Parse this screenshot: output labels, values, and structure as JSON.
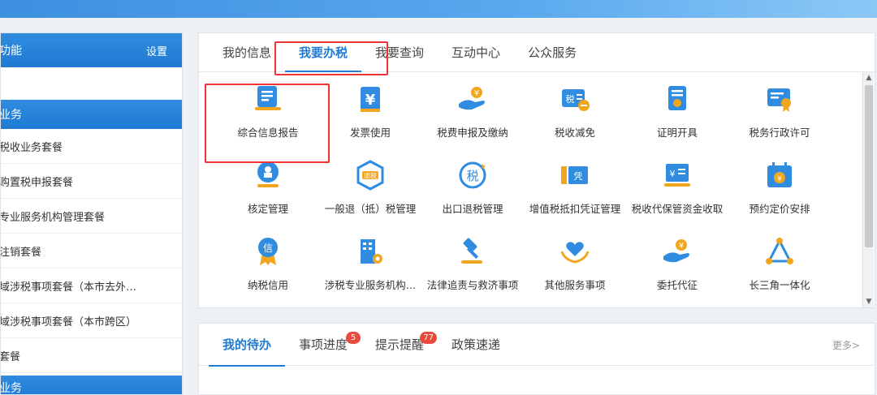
{
  "sidebar": {
    "header_title": "功能",
    "settings_label": "设置",
    "category1": "业务",
    "items": [
      "税收业务套餐",
      "购置税申报套餐",
      "专业服务机构管理套餐",
      "注销套餐",
      "域涉税事项套餐（本市去外…",
      "域涉税事项套餐（本市跨区）",
      "套餐"
    ],
    "category2": "业务"
  },
  "main": {
    "tabs": [
      "我的信息",
      "我要办税",
      "我要查询",
      "互动中心",
      "公众服务"
    ],
    "active_tab": "我要办税",
    "grid": [
      {
        "label": "综合信息报告",
        "icon": "report-document-icon"
      },
      {
        "label": "发票使用",
        "icon": "invoice-yuan-icon"
      },
      {
        "label": "税费申报及缴纳",
        "icon": "hand-coin-icon"
      },
      {
        "label": "税收减免",
        "icon": "tax-reduce-icon"
      },
      {
        "label": "证明开具",
        "icon": "certificate-icon"
      },
      {
        "label": "税务行政许可",
        "icon": "license-badge-icon"
      },
      {
        "label": "核定管理",
        "icon": "stamp-icon"
      },
      {
        "label": "一般退（抵）税管理",
        "icon": "refund-shield-icon"
      },
      {
        "label": "出口退税管理",
        "icon": "tax-circle-icon"
      },
      {
        "label": "增值税抵扣凭证管理",
        "icon": "voucher-icon"
      },
      {
        "label": "税收代保管资金收取",
        "icon": "cash-box-icon"
      },
      {
        "label": "预约定价安排",
        "icon": "calendar-yuan-icon"
      },
      {
        "label": "纳税信用",
        "icon": "credit-medal-icon"
      },
      {
        "label": "涉税专业服务机构…",
        "icon": "building-gear-icon"
      },
      {
        "label": "法律追责与救济事项",
        "icon": "gavel-icon"
      },
      {
        "label": "其他服务事项",
        "icon": "heart-hands-icon"
      },
      {
        "label": "委托代征",
        "icon": "hand-coin-icon"
      },
      {
        "label": "长三角一体化",
        "icon": "triangle-network-icon"
      }
    ]
  },
  "bottom": {
    "tabs": [
      {
        "label": "我的待办",
        "badge": null
      },
      {
        "label": "事项进度",
        "badge": "5"
      },
      {
        "label": "提示提醒",
        "badge": "77"
      },
      {
        "label": "政策速递",
        "badge": null
      }
    ],
    "more_label": "更多>"
  },
  "colors": {
    "accent": "#1f7bd2",
    "highlight_border": "#e33333",
    "badge": "#e84a3b"
  }
}
